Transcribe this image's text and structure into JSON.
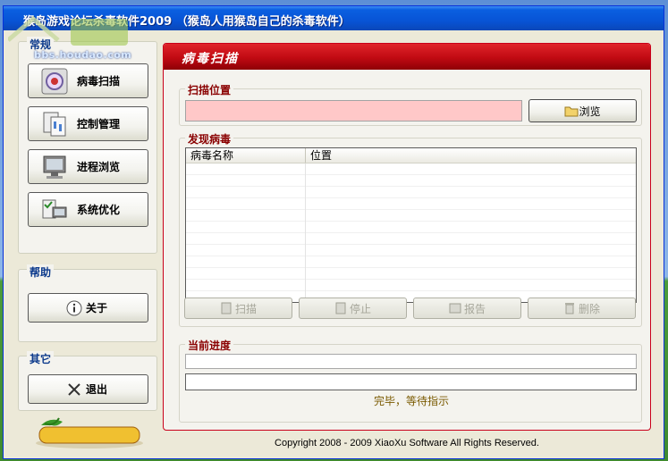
{
  "window": {
    "title": "猴岛游戏论坛杀毒软件2009  （猴岛人用猴岛自己的杀毒软件）"
  },
  "watermark": {
    "url": "bbs.houdao.com"
  },
  "sidebar": {
    "groups": [
      {
        "title": "常规",
        "items": [
          {
            "label": "病毒扫描",
            "icon": "virus-scan-icon"
          },
          {
            "label": "控制管理",
            "icon": "control-panel-icon"
          },
          {
            "label": "进程浏览",
            "icon": "process-monitor-icon"
          },
          {
            "label": "系统优化",
            "icon": "optimize-icon"
          }
        ]
      },
      {
        "title": "帮助",
        "items": [
          {
            "label": "关于",
            "icon": "info-icon"
          }
        ]
      },
      {
        "title": "其它",
        "items": [
          {
            "label": "退出",
            "icon": "close-icon"
          }
        ]
      }
    ]
  },
  "logo": {
    "text": "HOUDAO"
  },
  "main": {
    "panel_title": "病毒扫描",
    "scan_location": {
      "title": "扫描位置",
      "value": "",
      "browse_label": "浏览"
    },
    "found_viruses": {
      "title": "发现病毒",
      "columns": [
        "病毒名称",
        "位置"
      ],
      "rows": []
    },
    "actions": [
      {
        "label": "扫描",
        "icon": "scan-icon",
        "enabled": false
      },
      {
        "label": "停止",
        "icon": "stop-icon",
        "enabled": false
      },
      {
        "label": "报告",
        "icon": "report-icon",
        "enabled": false
      },
      {
        "label": "删除",
        "icon": "trash-icon",
        "enabled": false
      }
    ],
    "progress": {
      "title": "当前进度",
      "bar1_fraction": 0,
      "bar2_fraction": 0,
      "status": "完毕，等待指示"
    }
  },
  "footer": {
    "copyright": "Copyright 2008 - 2009 XiaoXu Software  All Rights Reserved."
  },
  "colors": {
    "panel_header": "#c00a12",
    "section_title": "#8a0000",
    "group_title": "#0c3a8c",
    "path_input_bg": "#ffc8c8"
  }
}
